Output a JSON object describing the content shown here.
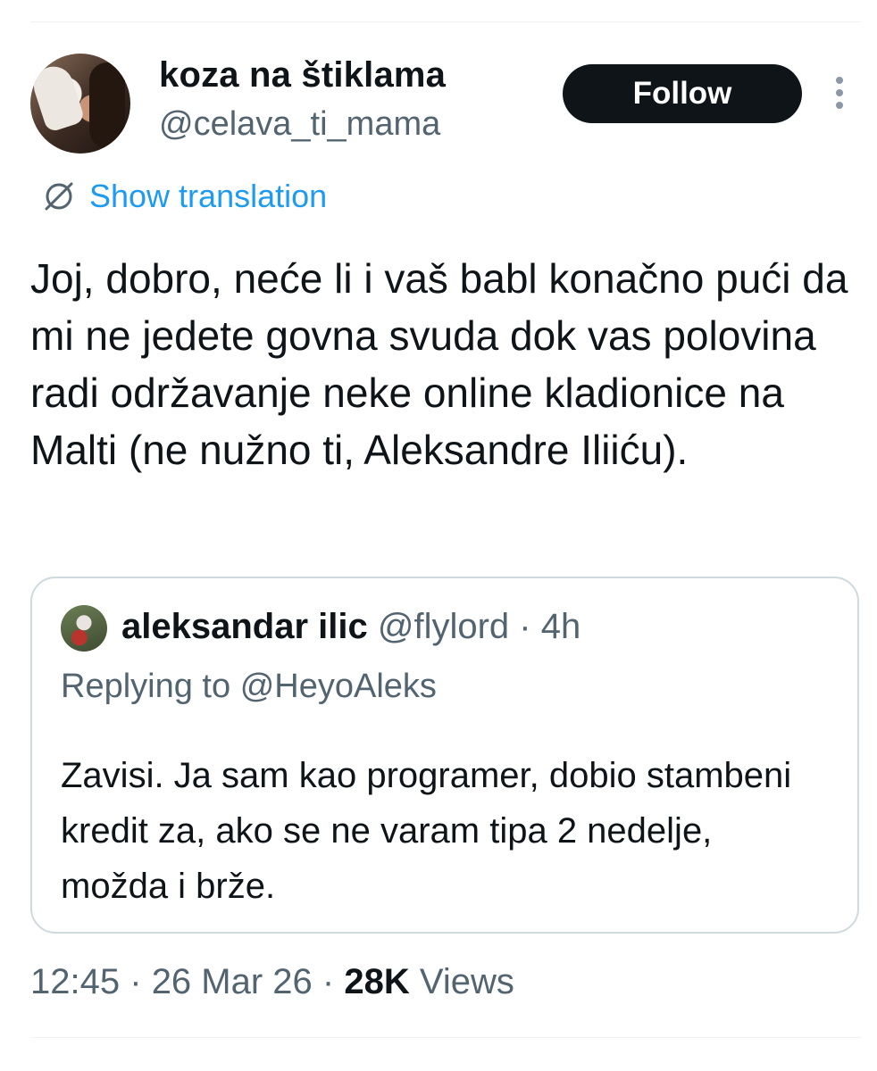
{
  "author": {
    "name": "koza na štiklama",
    "handle": "@celava_ti_mama",
    "avatar_icon": "profile-photo"
  },
  "follow_label": "Follow",
  "translation_label": "Show translation",
  "tweet_text": "Joj, dobro, neće li i vaš babl konačno pući da mi ne jedete govna svuda dok vas polovina radi održavanje neke online kladionice na Malti (ne nužno ti, Aleksandre Iliiću).",
  "quote": {
    "name": "aleksandar ilic",
    "handle": "@flylord",
    "separator": "·",
    "time": "4h",
    "replying_prefix": "Replying to",
    "replying_to": "@HeyoAleks",
    "text": "Zavisi. Ja sam kao programer, dobio stambeni kredit za, ako se ne varam tipa 2 nedelje, možda i brže."
  },
  "meta": {
    "time": "12:45",
    "separator": "·",
    "date": "26 Mar 26",
    "views_count": "28K",
    "views_label": "Views"
  },
  "colors": {
    "accent": "#1d9bf0",
    "text_secondary": "#536471",
    "button_bg": "#0f1419",
    "border": "#cfd9de"
  }
}
